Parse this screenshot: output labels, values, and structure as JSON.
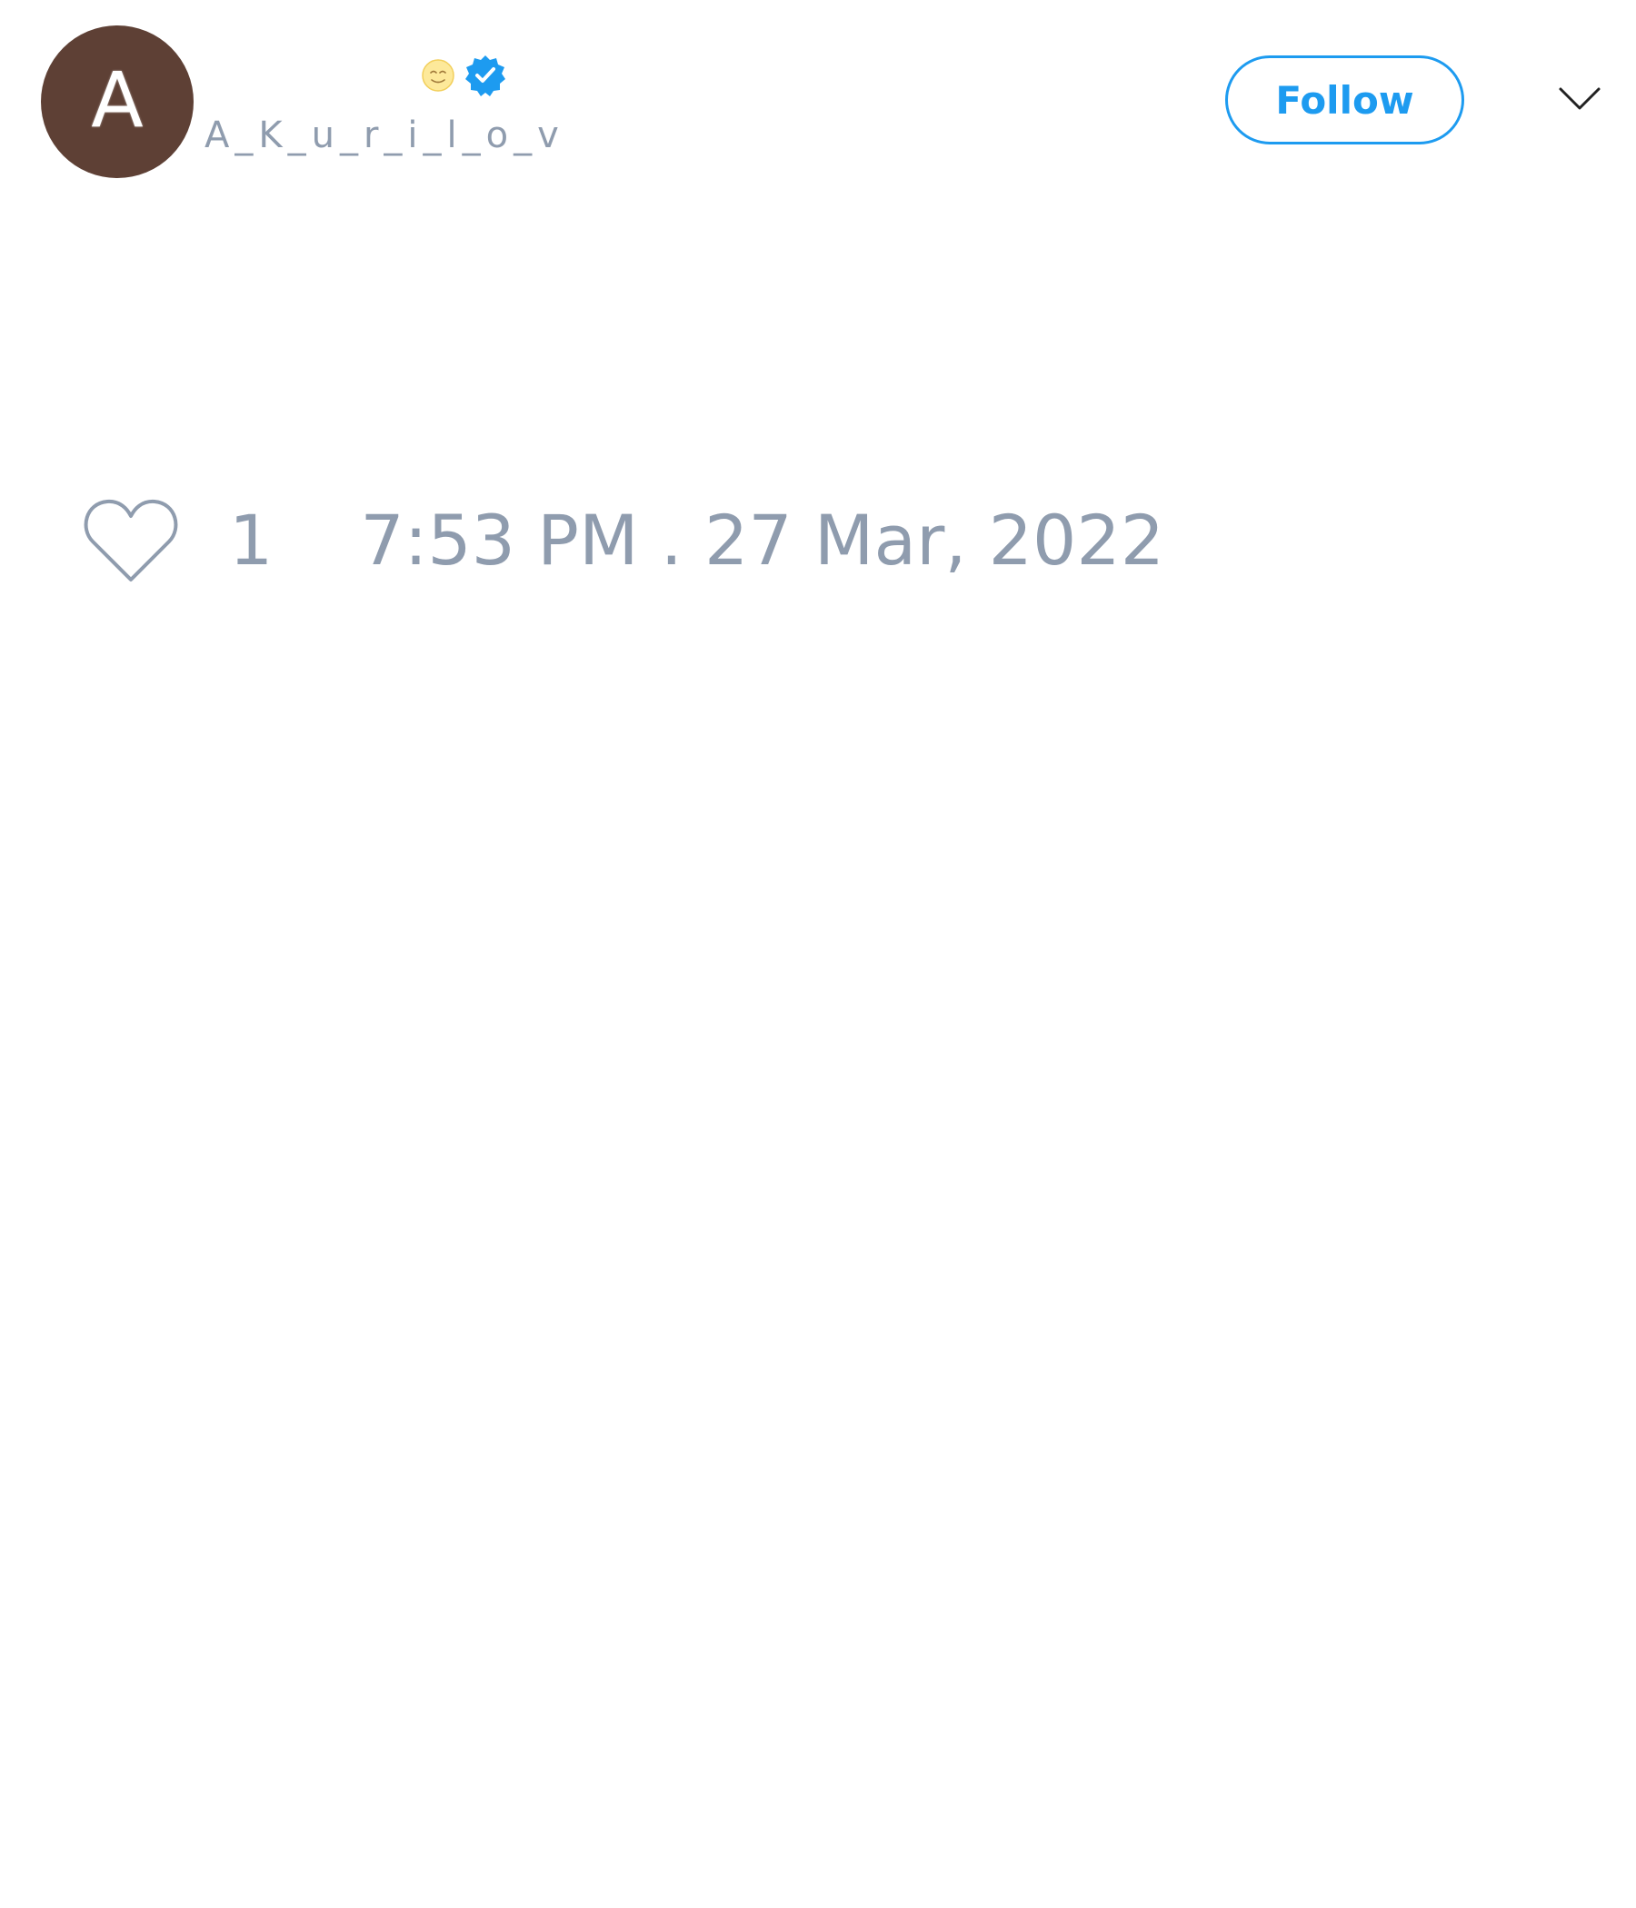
{
  "author": {
    "avatar_letter": "A",
    "handle": "A_K_u_r_i_l_o_v",
    "emoji_icon": "slightly-smiling-face-icon",
    "verified_icon": "verified-badge-icon"
  },
  "header": {
    "follow_label": "Follow",
    "menu_icon": "chevron-down-icon"
  },
  "footer": {
    "like_icon": "heart-icon",
    "like_count": "1",
    "timestamp": "7:53 PM . 27 Mar, 2022"
  },
  "colors": {
    "accent": "#1d9bf0",
    "muted_text": "#8f9cae",
    "avatar_bg": "#5e4035"
  }
}
